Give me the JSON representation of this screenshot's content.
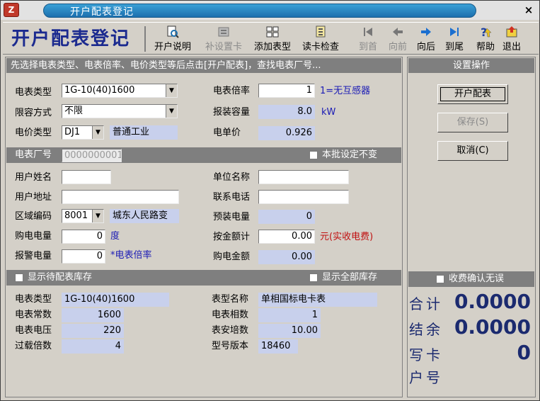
{
  "window": {
    "title": "开户配表登记",
    "close_glyph": "×",
    "app_icon_glyph": "Z"
  },
  "toolbar": {
    "big_title": "开户配表登记",
    "buttons": [
      {
        "label": "开户说明",
        "icon": "doc-search-icon",
        "glyph": "🔍",
        "enabled": true
      },
      {
        "label": "补设置卡",
        "icon": "card-icon",
        "glyph": "▦",
        "enabled": false
      },
      {
        "label": "添加表型",
        "icon": "add-meter-icon",
        "glyph": "⊞",
        "enabled": true
      },
      {
        "label": "读卡检查",
        "icon": "read-card-icon",
        "glyph": "▤",
        "enabled": true
      },
      {
        "label": "到首",
        "icon": "first-icon",
        "glyph": "⇤",
        "enabled": false
      },
      {
        "label": "向前",
        "icon": "prev-icon",
        "glyph": "⇦",
        "enabled": false
      },
      {
        "label": "向后",
        "icon": "next-icon",
        "glyph": "⇨",
        "enabled": true
      },
      {
        "label": "到尾",
        "icon": "last-icon",
        "glyph": "⇥",
        "enabled": true
      },
      {
        "label": "帮助",
        "icon": "help-icon",
        "glyph": "?",
        "enabled": true
      },
      {
        "label": "退出",
        "icon": "exit-icon",
        "glyph": "⇪",
        "enabled": true
      }
    ]
  },
  "main": {
    "instruction": "先选择电表类型、电表倍率、电价类型等后点击[开户配表]，查找电表厂号...",
    "meter_type": {
      "label": "电表类型",
      "value": "1G-10(40)1600"
    },
    "capacity_mode": {
      "label": "限容方式",
      "value": "不限"
    },
    "price_type": {
      "label": "电价类型",
      "value": "DJ1",
      "name": "普通工业"
    },
    "meter_ratio": {
      "label": "电表倍率",
      "value": "1",
      "hint": "1=无互感器"
    },
    "install_capacity": {
      "label": "报装容量",
      "value": "8.0",
      "unit": "kW"
    },
    "unit_price": {
      "label": "电单价",
      "value": "0.926"
    },
    "factory_no": {
      "label": "电表厂号",
      "value": "0000000001"
    },
    "batch_fixed": {
      "label": "本批设定不变"
    },
    "user_name": {
      "label": "用户姓名",
      "value": ""
    },
    "company_name": {
      "label": "单位名称",
      "value": ""
    },
    "user_address": {
      "label": "用户地址",
      "value": ""
    },
    "phone": {
      "label": "联系电话",
      "value": ""
    },
    "area_code": {
      "label": "区域编码",
      "value": "8001",
      "name": "城东人民路变"
    },
    "preset_power": {
      "label": "预装电量",
      "value": "0"
    },
    "purchase_power": {
      "label": "购电电量",
      "value": "0",
      "unit": "度"
    },
    "amount_total": {
      "label": "按金额计",
      "value": "0.00",
      "unit": "元(实收电费)"
    },
    "alarm_power": {
      "label": "报警电量",
      "value": "0",
      "unit": "*电表倍率"
    },
    "purchase_amount": {
      "label": "购电金额",
      "value": "0.00"
    },
    "show_pending_stock": {
      "label": "显示待配表库存"
    },
    "show_all_stock": {
      "label": "显示全部库存"
    },
    "stock": {
      "meter_type": {
        "label": "电表类型",
        "value": "1G-10(40)1600"
      },
      "meter_constant": {
        "label": "电表常数",
        "value": "1600"
      },
      "meter_voltage": {
        "label": "电表电压",
        "value": "220"
      },
      "overload_ratio": {
        "label": "过载倍数",
        "value": "4"
      },
      "model_name": {
        "label": "表型名称",
        "value": "单相国标电卡表"
      },
      "phase_count": {
        "label": "电表相数",
        "value": "1"
      },
      "ampere_ratio": {
        "label": "表安培数",
        "value": "10.00"
      },
      "model_version": {
        "label": "型号版本",
        "value": "18460"
      }
    }
  },
  "side": {
    "header": "设置操作",
    "open_button": "开户配表",
    "save_button": "保存(S)",
    "cancel_button": "取消(C)",
    "confirm_fee": {
      "label": "收费确认无误"
    },
    "total": {
      "label": "合计",
      "value": "0.0000"
    },
    "balance": {
      "label": "结余",
      "value": "0.0000"
    },
    "write_card": {
      "label": "写卡",
      "value": "0"
    },
    "account_no": {
      "label": "户号",
      "value": ""
    }
  },
  "colors": {
    "window_bg": "#d4d0c8",
    "header_bar": "#7f7f7f",
    "readonly_field": "#c8d0ec",
    "title_accent": "#1b2a8f",
    "warning_red": "#c01010"
  }
}
